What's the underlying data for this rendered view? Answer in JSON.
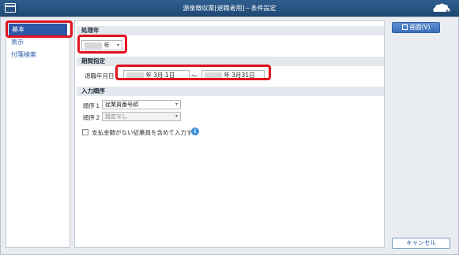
{
  "window": {
    "title": "源泉徴収票[退職者用]－条件設定",
    "brand_label": "AI"
  },
  "sidebar": {
    "items": [
      {
        "label": "基本",
        "active": true
      },
      {
        "label": "表示",
        "active": false
      },
      {
        "label": "付箋検索",
        "active": false
      }
    ]
  },
  "main": {
    "year_section": {
      "heading": "処理年",
      "year_suffix": "年",
      "caret": "▾"
    },
    "period_section": {
      "heading": "期間指定",
      "label": "退職年月日",
      "from_text": "年  3月  1日",
      "separator": "～",
      "to_text": "年  3月31日"
    },
    "order_section": {
      "heading": "入力順序",
      "order1_label": "順序１",
      "order1_value": "従業員番号順",
      "order2_label": "順序２",
      "order2_value": "設定なし",
      "caret": "▾"
    },
    "checkbox_label": "支払金額がない従業員を含めて入力する",
    "info_glyph": "i"
  },
  "buttons": {
    "screen_label": "画面(V)",
    "cancel_label": "キャンセル"
  },
  "colors": {
    "titlebar": "#1f4a76",
    "accent": "#2d57a8",
    "highlight": "#e0141e"
  }
}
